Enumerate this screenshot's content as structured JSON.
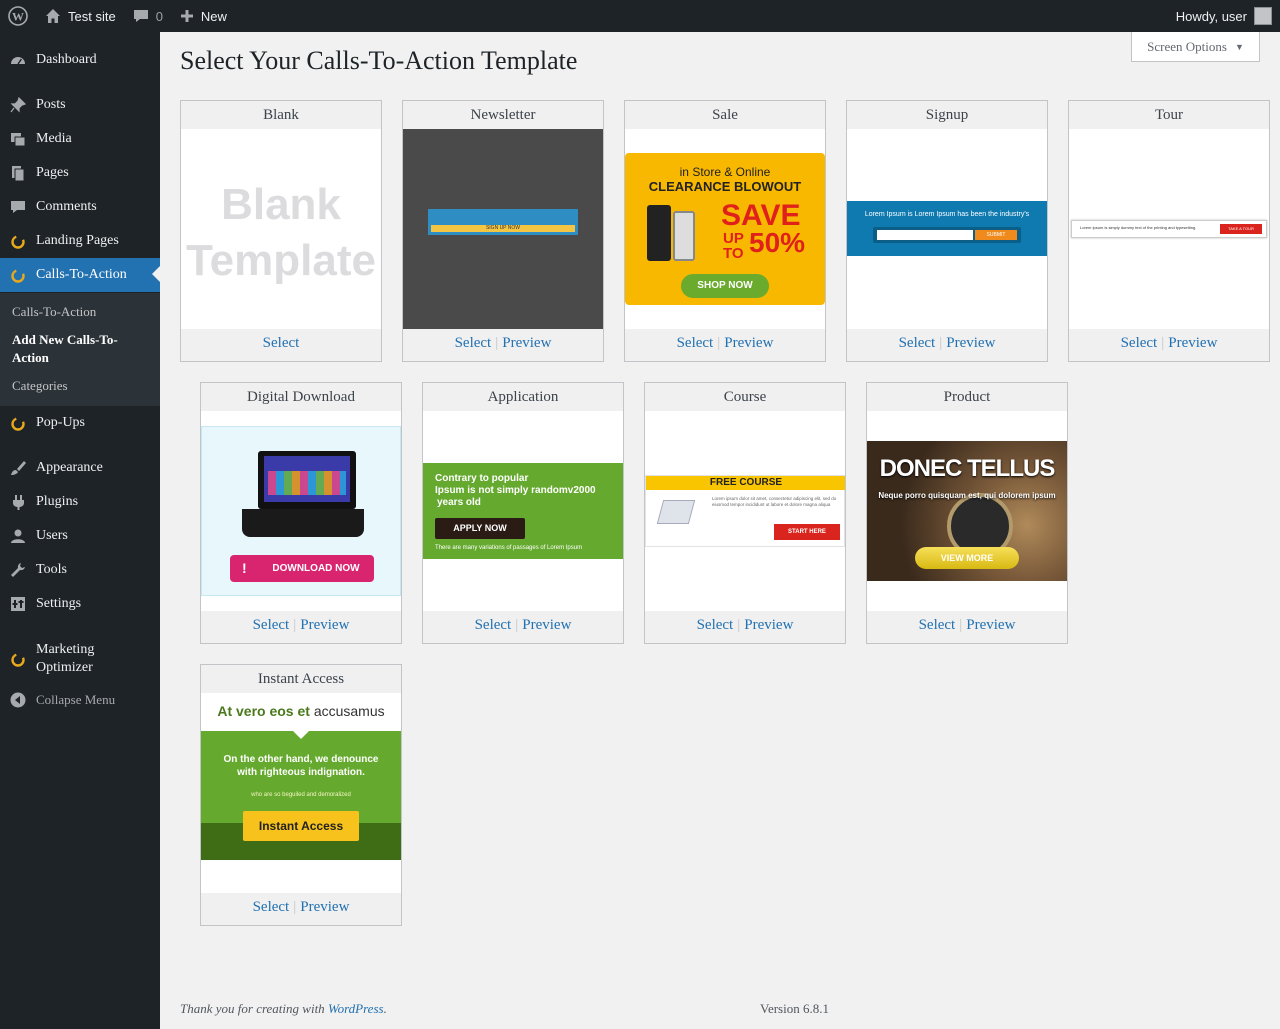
{
  "adminbar": {
    "site_name": "Test site",
    "comment_count": "0",
    "new_label": "New",
    "howdy": "Howdy, user"
  },
  "sidebar": {
    "items": [
      {
        "label": "Dashboard",
        "icon": "dashboard-icon"
      },
      {
        "label": "Posts",
        "icon": "pin-icon"
      },
      {
        "label": "Media",
        "icon": "media-icon"
      },
      {
        "label": "Pages",
        "icon": "pages-icon"
      },
      {
        "label": "Comments",
        "icon": "comment-icon"
      },
      {
        "label": "Landing Pages",
        "icon": "landing-pages-icon"
      },
      {
        "label": "Calls-To-Action",
        "icon": "cta-icon"
      },
      {
        "label": "Pop-Ups",
        "icon": "popups-icon"
      },
      {
        "label": "Appearance",
        "icon": "brush-icon"
      },
      {
        "label": "Plugins",
        "icon": "plug-icon"
      },
      {
        "label": "Users",
        "icon": "user-icon"
      },
      {
        "label": "Tools",
        "icon": "wrench-icon"
      },
      {
        "label": "Settings",
        "icon": "settings-icon"
      },
      {
        "label": "Marketing Optimizer",
        "icon": "marketing-optimizer-icon"
      },
      {
        "label": "Collapse Menu",
        "icon": "collapse-icon"
      }
    ],
    "submenu": [
      "Calls-To-Action",
      "Add New Calls-To-Action",
      "Categories"
    ]
  },
  "page": {
    "title": "Select Your Calls-To-Action Template",
    "screen_options": "Screen Options"
  },
  "templates": [
    {
      "name": "Blank",
      "select": "Select",
      "preview": ""
    },
    {
      "name": "Newsletter",
      "select": "Select",
      "preview": "Preview"
    },
    {
      "name": "Sale",
      "select": "Select",
      "preview": "Preview"
    },
    {
      "name": "Signup",
      "select": "Select",
      "preview": "Preview"
    },
    {
      "name": "Tour",
      "select": "Select",
      "preview": "Preview"
    },
    {
      "name": "Digital Download",
      "select": "Select",
      "preview": "Preview"
    },
    {
      "name": "Application",
      "select": "Select",
      "preview": "Preview"
    },
    {
      "name": "Course",
      "select": "Select",
      "preview": "Preview"
    },
    {
      "name": "Product",
      "select": "Select",
      "preview": "Preview"
    },
    {
      "name": "Instant Access",
      "select": "Select",
      "preview": "Preview"
    }
  ],
  "thumbs": {
    "blank": {
      "line1": "Blank",
      "line2": "Template"
    },
    "newsletter": {
      "button": "SIGN UP NOW"
    },
    "sale": {
      "line1": "in Store & Online",
      "line2": "CLEARANCE BLOWOUT",
      "save": "SAVE",
      "up": "UP",
      "to": "TO",
      "pct": "50%",
      "button": "SHOP NOW"
    },
    "signup": {
      "text": "Lorem Ipsum is Lorem Ipsum has been the industry's",
      "button": "SUBMIT"
    },
    "tour": {
      "text": "Lorem Ipsum is simply dummy text of the printing and typesetting.",
      "button": "TAKE A TOUR"
    },
    "download": {
      "button": "DOWNLOAD NOW"
    },
    "application": {
      "line1": "Contrary to popular",
      "line2": "Ipsum is not simply randomv2000",
      "line3": "years old",
      "button": "APPLY NOW",
      "small": "There are many variations of passages of Lorem Ipsum"
    },
    "course": {
      "banner": "FREE COURSE",
      "text": "Lorem ipsum dolor sit amet, consectetur adipiscing elit, sed do eiusmod tempor incididunt ut labore et dolore magna aliqua",
      "button": "START HERE"
    },
    "product": {
      "title": "DONEC TELLUS",
      "sub": "Neque porro quisquam est, qui dolorem ipsum",
      "button": "VIEW MORE"
    },
    "instant": {
      "head_bold": "At vero eos et",
      "head_rest": "accusamus",
      "line1": "On the other hand, we denounce",
      "line2": "with righteous indignation.",
      "small": "who are so beguiled and demoralized",
      "button": "Instant Access"
    }
  },
  "footer": {
    "thanks": "Thank you for creating with",
    "wp": "WordPress",
    "period": ".",
    "version": "Version 6.8.1"
  },
  "colors": {
    "accent": "#2271b1",
    "adminbar": "#1d2327"
  }
}
